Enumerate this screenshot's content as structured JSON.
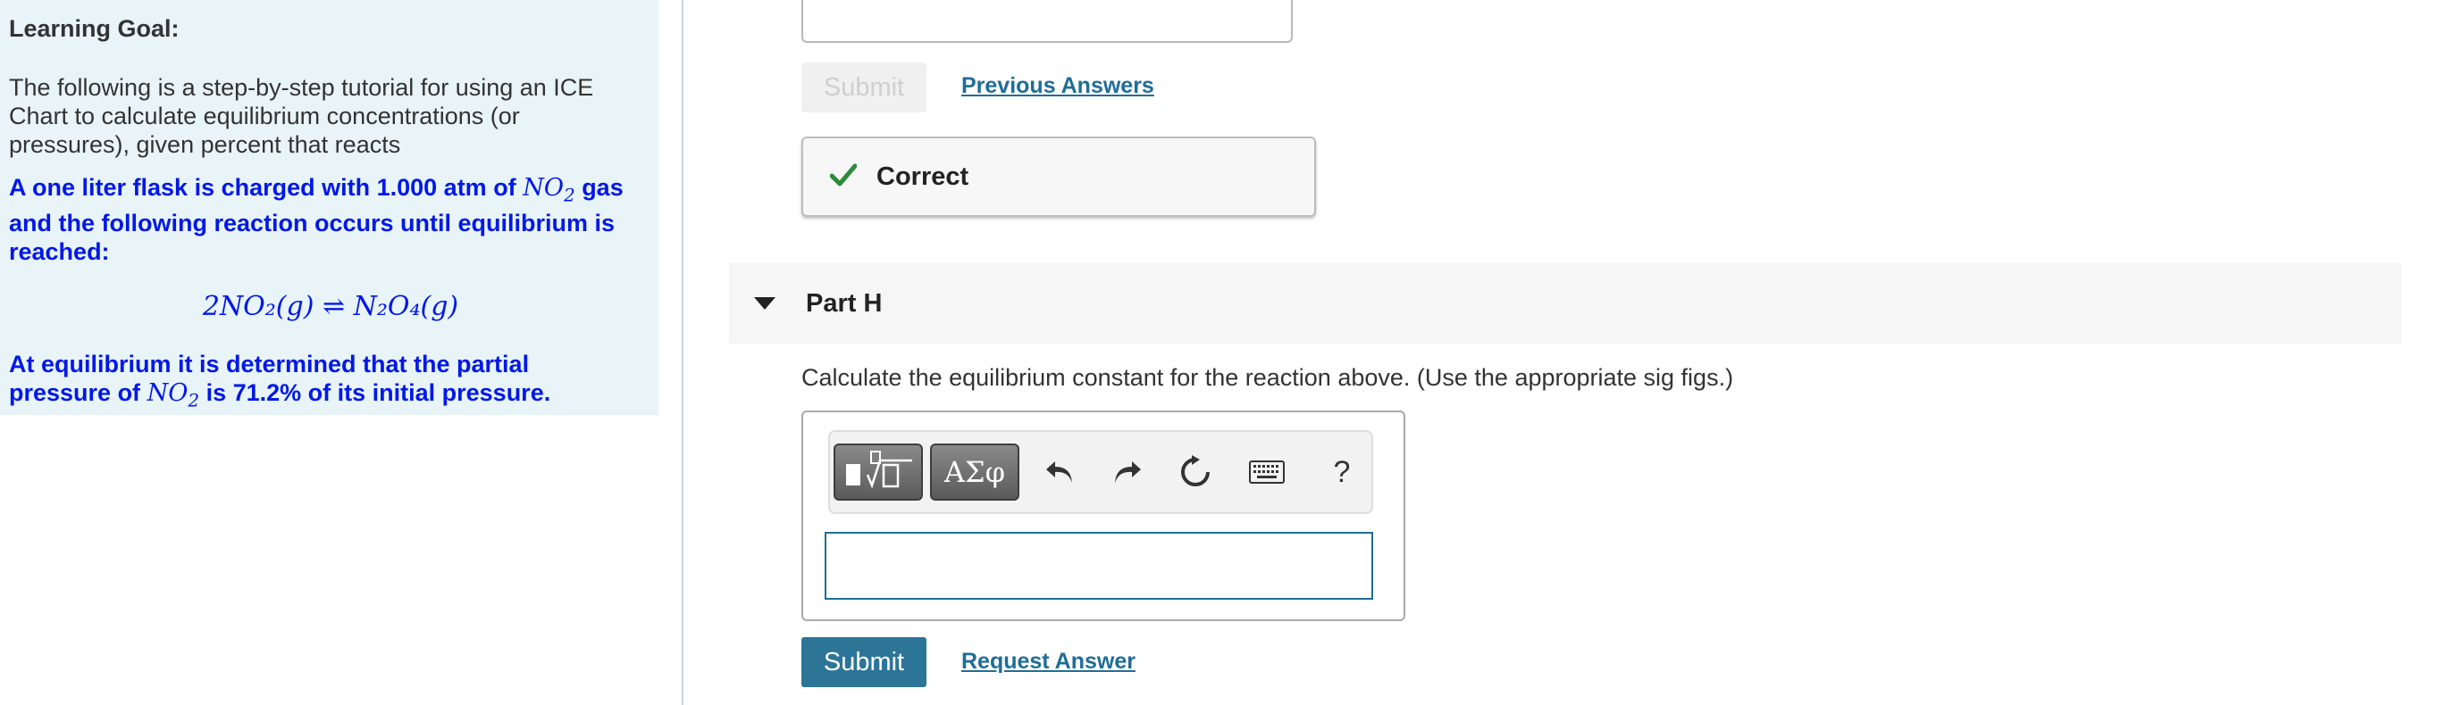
{
  "learning_goal": {
    "title": "Learning Goal:",
    "intro": "The following is a step-by-step tutorial for using an ICE Chart to calculate equilibrium concentrations (or pressures), given percent that reacts",
    "statement_pre": "A one liter flask is charged with 1.000 atm of ",
    "statement_species": "NO",
    "statement_sub": "2",
    "statement_post": " gas and the following reaction occurs until equilibrium is reached:",
    "equation": "2NO₂(g) ⇌ N₂O₄(g)",
    "result_pre": "At equilibrium it is determined that the partial pressure of ",
    "result_species": "NO",
    "result_sub": "2",
    "result_post": " is 71.2% of its initial pressure."
  },
  "previous_part": {
    "submit_label": "Submit",
    "previous_answers_label": "Previous Answers",
    "feedback": "Correct"
  },
  "part_h": {
    "title": "Part H",
    "question": "Calculate the equilibrium constant for the reaction above. (Use the appropriate sig figs.)",
    "toolbar": {
      "greek_label": "ΑΣφ",
      "help_label": "?"
    },
    "answer_value": "",
    "submit_label": "Submit",
    "request_answer_label": "Request Answer"
  },
  "colors": {
    "panel_bg": "#e8f4f7",
    "blue_text": "#0018e8",
    "link": "#1f6d97",
    "submit_bg": "#2c7597",
    "correct_check": "#2e8b3a"
  }
}
